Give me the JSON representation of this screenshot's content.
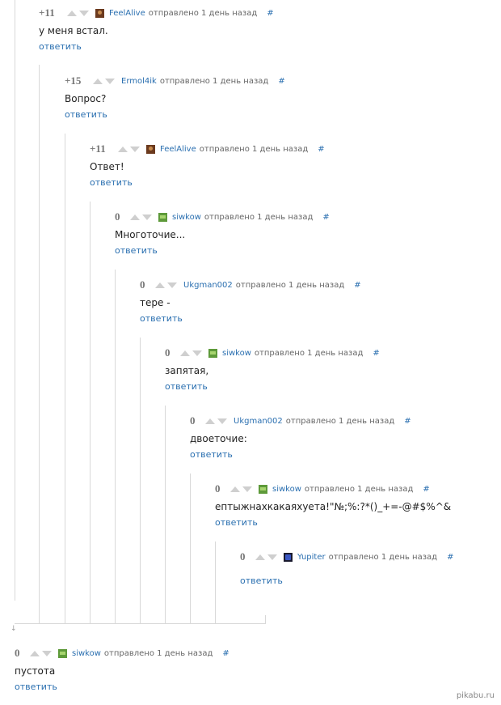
{
  "meta_text": {
    "sent": "отправлено 1 день назад",
    "hash": "#",
    "reply": "ответить"
  },
  "comments": [
    {
      "score": "+11",
      "author": "FeelAlive",
      "avatar": "brown",
      "text": "у меня встал."
    },
    {
      "score": "+15",
      "author": "Ermol4ik",
      "avatar": "none",
      "text": "Вопрос?"
    },
    {
      "score": "+11",
      "author": "FeelAlive",
      "avatar": "brown",
      "text": "Ответ!"
    },
    {
      "score": "0",
      "author": "siwkow",
      "avatar": "green",
      "text": "Многоточие..."
    },
    {
      "score": "0",
      "author": "Ukgman002",
      "avatar": "none",
      "text": "тере -"
    },
    {
      "score": "0",
      "author": "siwkow",
      "avatar": "green",
      "text": "запятая,"
    },
    {
      "score": "0",
      "author": "Ukgman002",
      "avatar": "none",
      "text": "двоеточие:"
    },
    {
      "score": "0",
      "author": "siwkow",
      "avatar": "green",
      "text": "ептыжнахкакаяхуета!\"№;%:?*()_+=-@#$%^&"
    },
    {
      "score": "0",
      "author": "Yupiter",
      "avatar": "dark",
      "text": ""
    },
    {
      "score": "0",
      "author": "siwkow",
      "avatar": "green",
      "text": "пустота"
    }
  ],
  "watermark": "pikabu.ru"
}
